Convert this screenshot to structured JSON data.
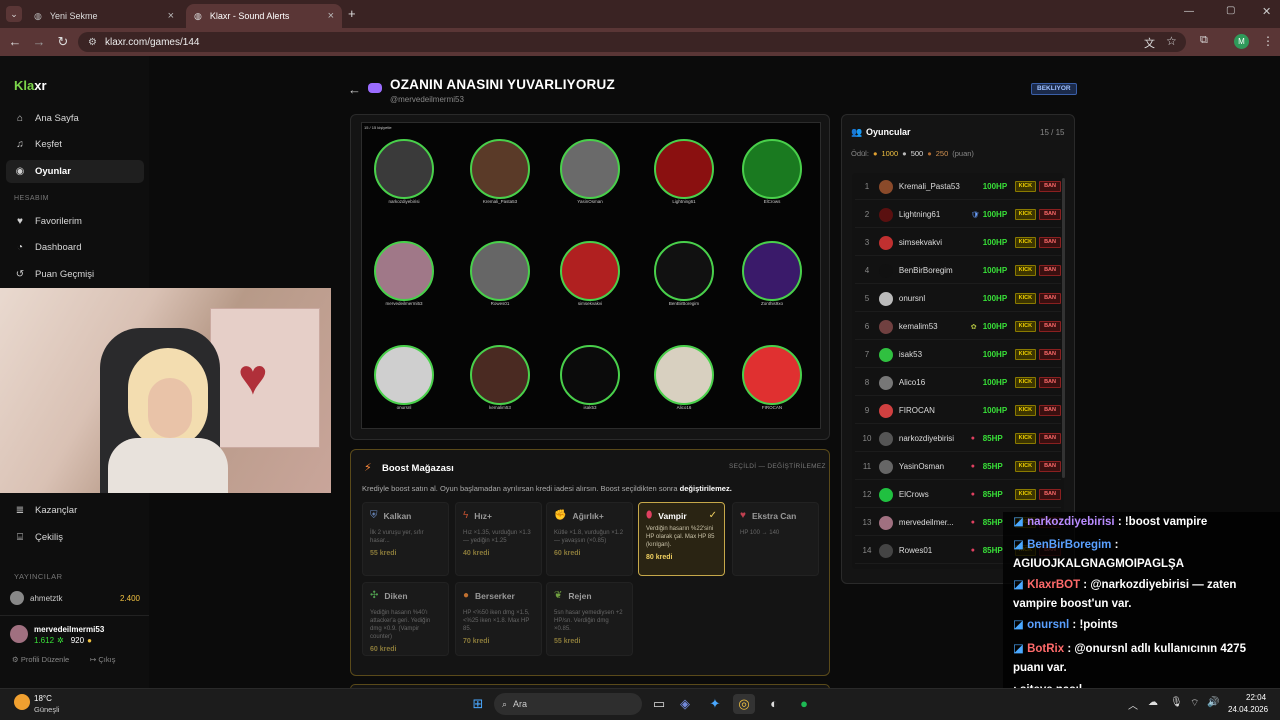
{
  "browser": {
    "tabs": [
      {
        "label": "Yeni Sekme"
      },
      {
        "label": "Klaxr - Sound Alerts"
      }
    ],
    "url": "klaxr.com/games/144",
    "profile": "M"
  },
  "sidebar": {
    "logo_a": "Kla",
    "logo_b": "xr",
    "items": [
      {
        "label": "Ana Sayfa",
        "icon": "home-icon"
      },
      {
        "label": "Keşfet",
        "icon": "music-icon"
      },
      {
        "label": "Oyunlar",
        "icon": "gamepad-icon"
      }
    ],
    "section": "HESABIM",
    "account": [
      {
        "label": "Favorilerim",
        "icon": "heart-icon"
      },
      {
        "label": "Dashboard",
        "icon": "dashboard-icon"
      },
      {
        "label": "Puan Geçmişi",
        "icon": "history-icon"
      }
    ],
    "more": [
      {
        "label": "Kazançlar",
        "icon": "layers-icon"
      },
      {
        "label": "Çekiliş",
        "icon": "gift-icon"
      }
    ],
    "streamers_label": "YAYINCILAR",
    "streamer": {
      "name": "ahmetztk",
      "points": "2.400"
    },
    "user": {
      "name": "mervedeilmermi53",
      "points_a": "1.612",
      "points_b": "920"
    },
    "edit_profile": "Profili Düzenle",
    "logout": "Çıkış"
  },
  "game": {
    "title": "OZANIN ANASINI YUVARLIYORUZ",
    "owner": "@mervedeilmermi53",
    "status": "BEKLIYOR",
    "arena_label": "15 / 15 kişiyetle"
  },
  "arena_players": [
    "narkozdiyebirisi",
    "Kremali_Pasta53",
    "YasinOsman",
    "Lightning61",
    "ElCrows",
    "mervedeilmermi53",
    "Rowes01",
    "simsekvakvi",
    "BenBirBoregim",
    "Zonthis9xo",
    "onursnl",
    "kemalim53",
    "isak53",
    "Alico16",
    "FIROCAN"
  ],
  "boost": {
    "title": "Boost Mağazası",
    "mode": "SEÇİLDİ — DEĞİŞTİRİLEMEZ",
    "desc_a": "Krediyle boost satın al. Oyun başlamadan ayrılırsan kredi iadesi alırsın. Boost seçildikten sonra ",
    "desc_b": "değiştirilemez.",
    "cards": [
      {
        "name": "Kalkan",
        "desc": "İlk 2 vuruşu yer, sıfır hasar...",
        "price": "55 kredi",
        "icon": "shield-icon"
      },
      {
        "name": "Hız+",
        "desc": "Hız ×1.35, vurduğun ×1.3 — yediğin ×1.25",
        "price": "40 kredi",
        "icon": "bolt-icon"
      },
      {
        "name": "Ağırlık+",
        "desc": "Kütle ×1.8, vurduğun ×1.2 — yavaşsın (×0.85)",
        "price": "60 kredi",
        "icon": "muscle-icon"
      },
      {
        "name": "Vampir",
        "desc": "Verdiğin hasarın %22'sini HP olarak çal. Max HP 85 (kırılgan).",
        "price": "80 kredi",
        "icon": "drop-icon",
        "selected": true
      },
      {
        "name": "Ekstra Can",
        "desc": "HP 100 → 140",
        "price": "",
        "icon": "heart-icon"
      },
      {
        "name": "Diken",
        "desc": "Yediğin hasarın %40'ı attacker'a geri. Yediğin dmg ×0.9. (Vampir counter)",
        "price": "60 kredi",
        "icon": "cactus-icon"
      },
      {
        "name": "Berserker",
        "desc": "HP <%50 iken dmg ×1.5, <%25 iken ×1.8. Max HP 85.",
        "price": "70 kredi",
        "icon": "fire-icon"
      },
      {
        "name": "Rejen",
        "desc": "5sn hasar yemediysen +2 HP/sn. Verdiğin dmg ×0.85.",
        "price": "55 kredi",
        "icon": "leaf-icon"
      }
    ]
  },
  "players": {
    "title": "Oyuncular",
    "count": "15 / 15",
    "reward_label": "Ödül:",
    "rewards": [
      "1000",
      "500",
      "250"
    ],
    "reward_unit": "(puan)",
    "rows": [
      {
        "n": "1",
        "name": "Kremali_Pasta53",
        "hp": "100HP",
        "s": "",
        "c": "#8a4a2a"
      },
      {
        "n": "2",
        "name": "Lightning61",
        "hp": "100HP",
        "s": "🛡",
        "c": "#5a1010"
      },
      {
        "n": "3",
        "name": "simsekvakvi",
        "hp": "100HP",
        "s": "",
        "c": "#c03030"
      },
      {
        "n": "4",
        "name": "BenBirBoregim",
        "hp": "100HP",
        "s": "",
        "c": "#111"
      },
      {
        "n": "5",
        "name": "onursnl",
        "hp": "100HP",
        "s": "",
        "c": "#bbb"
      },
      {
        "n": "6",
        "name": "kemalim53",
        "hp": "100HP",
        "s": "✿",
        "c": "#704040"
      },
      {
        "n": "7",
        "name": "isak53",
        "hp": "100HP",
        "s": "",
        "c": "#30c040"
      },
      {
        "n": "8",
        "name": "Alico16",
        "hp": "100HP",
        "s": "",
        "c": "#777"
      },
      {
        "n": "9",
        "name": "FIROCAN",
        "hp": "100HP",
        "s": "",
        "c": "#d04040"
      },
      {
        "n": "10",
        "name": "narkozdiyebirisi",
        "hp": "85HP",
        "s": "●",
        "c": "#555"
      },
      {
        "n": "11",
        "name": "YasinOsman",
        "hp": "85HP",
        "s": "●",
        "c": "#666"
      },
      {
        "n": "12",
        "name": "ElCrows",
        "hp": "85HP",
        "s": "●",
        "c": "#20c040"
      },
      {
        "n": "13",
        "name": "mervedeilmer...",
        "hp": "85HP",
        "s": "●",
        "c": "#a07080"
      },
      {
        "n": "14",
        "name": "Rowes01",
        "hp": "85HP",
        "s": "●",
        "c": "#444"
      }
    ],
    "kick": "KICK",
    "ban": "BAN"
  },
  "chat": [
    {
      "user": "narkozdiyebirisi",
      "text": " : !boost vampire",
      "color": "#b98cff"
    },
    {
      "user": "BenBirBoregim",
      "text": " :",
      "color": "#5aa0ff",
      "line2": "AGIUOJKALGNAGMOIPAGLŞA"
    },
    {
      "user": "KlaxrBOT",
      "text": " : @narkozdiyebirisi — zaten",
      "color": "#ff6b6b",
      "line2": "vampire boost'un var.",
      "mention": true
    },
    {
      "user": "onursnl",
      "text": " : !points",
      "color": "#5aa0ff"
    },
    {
      "user": "BotRix",
      "text": " : @onursnl adlı kullanıcının 4275",
      "color": "#ff6b6b",
      "line2": "puanı var."
    },
    {
      "user": "",
      "text": " : siteye nasıl",
      "color": "#fff"
    }
  ],
  "taskbar": {
    "temp": "18°C",
    "weather": "Güneşli",
    "search": "Ara",
    "time": "22:04",
    "date": "24.04.2026"
  }
}
